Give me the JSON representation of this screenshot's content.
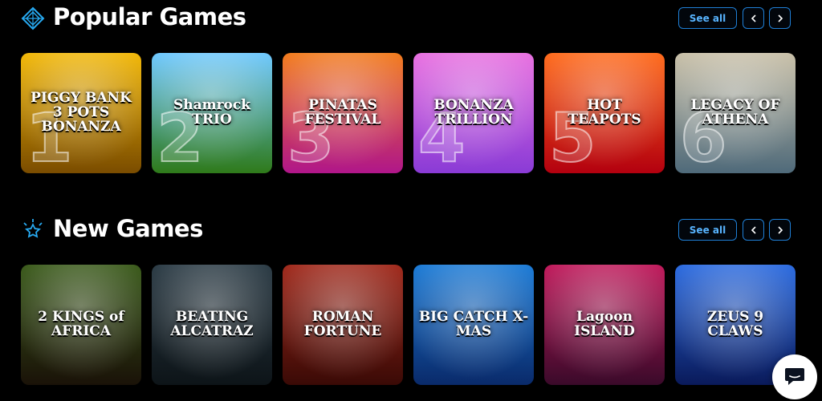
{
  "popular": {
    "title": "Popular Games",
    "icon": "diamond-icon",
    "see_all_label": "See all",
    "games": [
      {
        "title": "PIGGY BANK 3 POTS BONANZA",
        "rank": "1",
        "colors": [
          "#f2b705",
          "#7a4c00"
        ]
      },
      {
        "title": "Shamrock TRIO",
        "rank": "2",
        "colors": [
          "#6dc8ff",
          "#2f7a1a"
        ]
      },
      {
        "title": "PINATAS FESTIVAL",
        "rank": "3",
        "colors": [
          "#f27a1a",
          "#b0168a"
        ]
      },
      {
        "title": "BONANZA TRILLION",
        "rank": "4",
        "colors": [
          "#e86fe0",
          "#8a3bd6"
        ]
      },
      {
        "title": "HOT TEAPOTS",
        "rank": "5",
        "colors": [
          "#ff6a1a",
          "#b3000f"
        ]
      },
      {
        "title": "LEGACY OF ATHENA",
        "rank": "6",
        "colors": [
          "#c9c0a8",
          "#4f6a7a"
        ]
      }
    ]
  },
  "new_games": {
    "title": "New Games",
    "icon": "sparkle-star-icon",
    "see_all_label": "See all",
    "games": [
      {
        "title": "2 KINGS of AFRICA",
        "colors": [
          "#3a5a1a",
          "#1a1208"
        ]
      },
      {
        "title": "BEATING ALCATRAZ",
        "colors": [
          "#2a3a44",
          "#0d1418"
        ]
      },
      {
        "title": "ROMAN FORTUNE",
        "colors": [
          "#a0281a",
          "#3a0a06"
        ]
      },
      {
        "title": "BIG CATCH X-MAS",
        "colors": [
          "#1a7ad6",
          "#0a2a6a"
        ]
      },
      {
        "title": "Lagoon ISLAND",
        "colors": [
          "#c0185a",
          "#3a0a2a"
        ]
      },
      {
        "title": "ZEUS 9 CLAWS",
        "colors": [
          "#2a6ae0",
          "#0a1a5a"
        ]
      }
    ]
  },
  "accent_color": "#1f7fd6",
  "chat": {
    "icon": "chat-bubble-icon"
  }
}
